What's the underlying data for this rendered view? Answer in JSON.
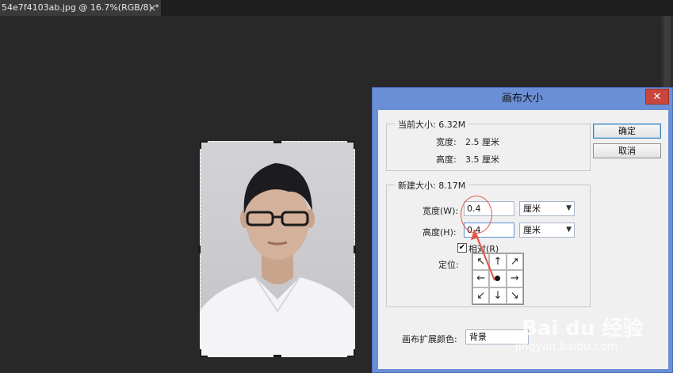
{
  "tab": {
    "title": "54e7f4103ab.jpg @ 16.7%(RGB/8) *",
    "close": "×"
  },
  "dialog": {
    "title": "画布大小",
    "close": "✕",
    "current": {
      "legend": "当前大小: 6.32M",
      "width_label": "宽度:",
      "width_value": "2.5 厘米",
      "height_label": "高度:",
      "height_value": "3.5 厘米"
    },
    "new": {
      "legend": "新建大小: 8.17M",
      "width_label": "宽度(W):",
      "width_value": "0.4",
      "width_unit": "厘米",
      "height_label": "高度(H):",
      "height_value": "0.4",
      "height_unit": "厘米",
      "relative_label": "相对(R)",
      "relative_checked": "✔",
      "anchor_label": "定位:"
    },
    "anchor_grid": [
      "↖",
      "↑",
      "↗",
      "←",
      "",
      "→",
      "↙",
      "↓",
      "↘"
    ],
    "extension_label": "画布扩展颜色:",
    "extension_value": "背景",
    "ok_label": "确定",
    "cancel_label": "取消"
  },
  "watermark": {
    "brand": "Bai du 经验",
    "url": "jingyan.baidu.com"
  },
  "colors": {
    "title_bar": "#6b8fd6",
    "close_button": "#c9463d",
    "annotation": "#e0584f"
  }
}
